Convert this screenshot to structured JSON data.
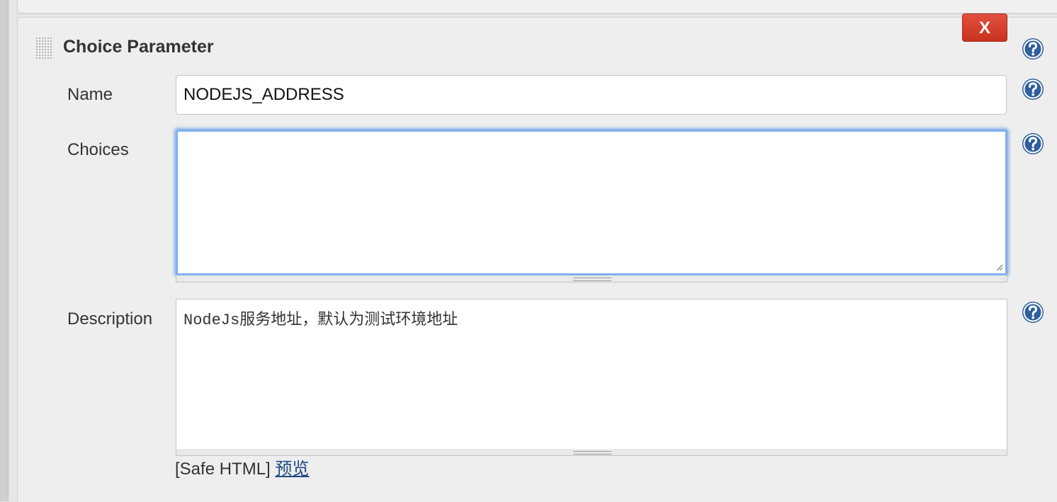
{
  "section": {
    "title": "Choice Parameter",
    "delete_label": "X"
  },
  "fields": {
    "name": {
      "label": "Name",
      "value": "NODEJS_ADDRESS"
    },
    "choices": {
      "label": "Choices",
      "value": ""
    },
    "description": {
      "label": "Description",
      "value": "NodeJs服务地址，默认为测试环境地址"
    }
  },
  "footer": {
    "safe_html_prefix": "[Safe HTML]",
    "preview_link": "预览"
  },
  "icons": {
    "help": "help-icon",
    "drag": "drag-handle-icon",
    "delete": "close-icon"
  },
  "colors": {
    "delete_button": "#d9402c",
    "help_icon": "#2f5f9e",
    "focus_ring": "#7fb0ef",
    "link": "#204a87"
  }
}
